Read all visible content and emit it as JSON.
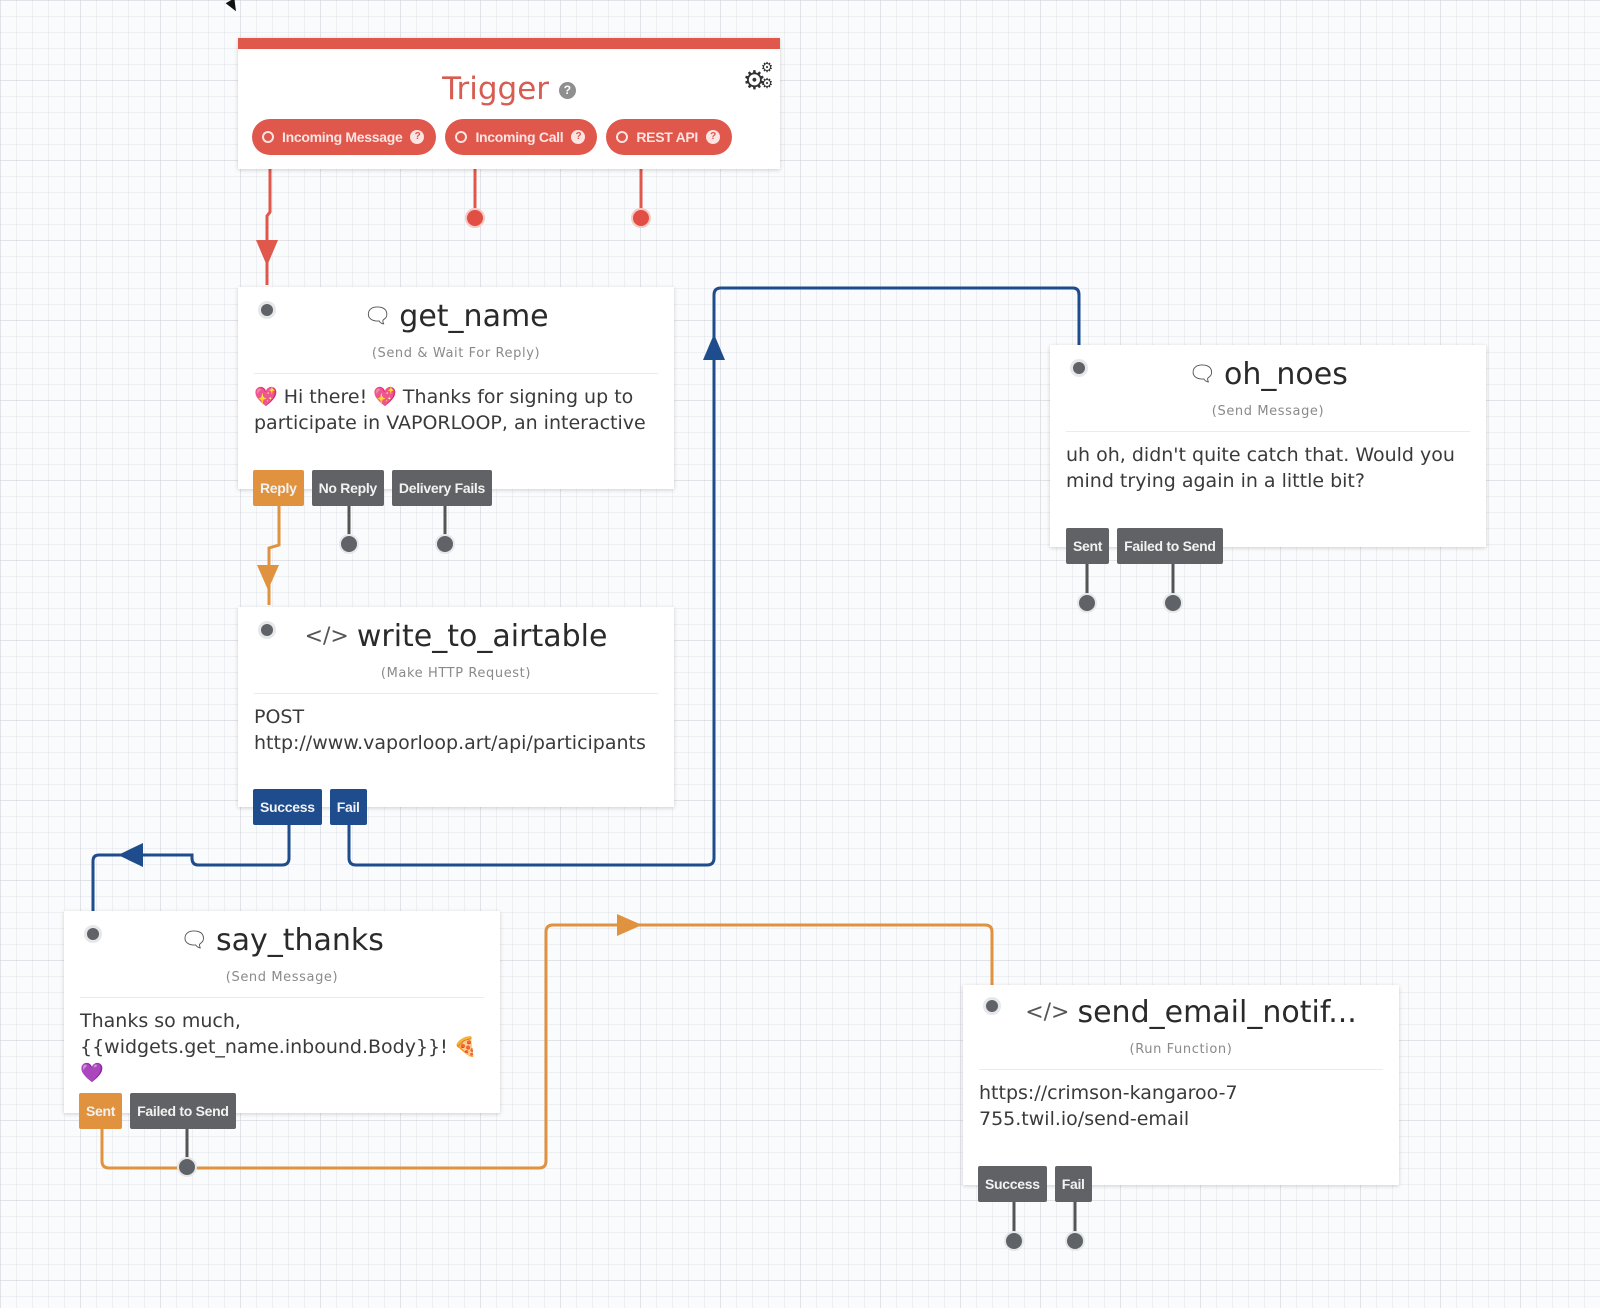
{
  "canvas": {
    "colors": {
      "trigger_red": "#e0574c",
      "orange": "#e0923e",
      "blue": "#1e4c8c",
      "gray": "#606265"
    }
  },
  "trigger": {
    "title": "Trigger",
    "help_icon": "question-circle-icon",
    "settings_icon": "gears-icon",
    "pills": [
      {
        "label": "Incoming Message"
      },
      {
        "label": "Incoming Call"
      },
      {
        "label": "REST API"
      }
    ]
  },
  "widgets": {
    "get_name": {
      "icon": "chat-bubbles-icon",
      "name": "get_name",
      "type": "(Send & Wait For Reply)",
      "body": "💖 Hi there! 💖 Thanks for signing up to participate in VAPORLOOP, an interactive",
      "ports": [
        {
          "label": "Reply",
          "state": "connected"
        },
        {
          "label": "No Reply",
          "state": "unconnected"
        },
        {
          "label": "Delivery Fails",
          "state": "unconnected"
        }
      ]
    },
    "write_to_airtable": {
      "icon": "code-icon",
      "name": "write_to_airtable",
      "type": "(Make HTTP Request)",
      "method": "POST",
      "url": "http://www.vaporloop.art/api/participants",
      "ports": [
        {
          "label": "Success",
          "state": "connected"
        },
        {
          "label": "Fail",
          "state": "connected"
        }
      ]
    },
    "oh_noes": {
      "icon": "chat-bubbles-icon",
      "name": "oh_noes",
      "type": "(Send Message)",
      "body": "uh oh, didn't quite catch that. Would you mind trying again in a little bit?",
      "ports": [
        {
          "label": "Sent",
          "state": "unconnected"
        },
        {
          "label": "Failed to Send",
          "state": "unconnected"
        }
      ]
    },
    "say_thanks": {
      "icon": "chat-bubbles-icon",
      "name": "say_thanks",
      "type": "(Send Message)",
      "body_line1": "Thanks so much,",
      "body_line2": "{{widgets.get_name.inbound.Body}}! 🍕💜",
      "ports": [
        {
          "label": "Sent",
          "state": "connected"
        },
        {
          "label": "Failed to Send",
          "state": "unconnected"
        }
      ]
    },
    "send_email_notif": {
      "icon": "code-icon",
      "name": "send_email_notif...",
      "type": "(Run Function)",
      "body": "https://crimson-kangaroo-7755.twil.io/send-email",
      "ports": [
        {
          "label": "Success",
          "state": "unconnected"
        },
        {
          "label": "Fail",
          "state": "unconnected"
        }
      ]
    }
  },
  "connections": [
    {
      "from": "trigger.Incoming Message",
      "to": "get_name",
      "color": "red"
    },
    {
      "from": "get_name.Reply",
      "to": "write_to_airtable",
      "color": "orange"
    },
    {
      "from": "write_to_airtable.Success",
      "to": "say_thanks",
      "color": "blue"
    },
    {
      "from": "write_to_airtable.Fail",
      "to": "oh_noes",
      "color": "blue"
    },
    {
      "from": "say_thanks.Sent",
      "to": "send_email_notif...",
      "color": "orange"
    }
  ]
}
